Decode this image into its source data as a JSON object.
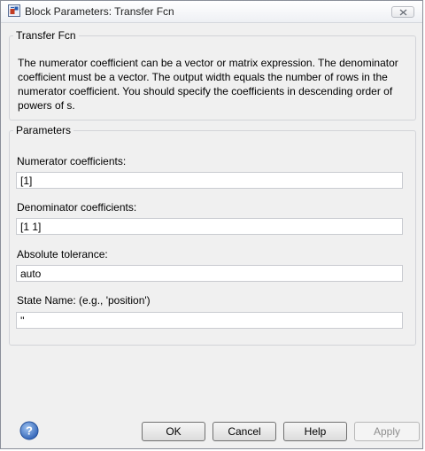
{
  "window": {
    "title": "Block Parameters: Transfer Fcn"
  },
  "block_group": {
    "legend": "Transfer Fcn",
    "description": "The numerator coefficient can be a vector or matrix expression. The denominator coefficient must be a vector. The output width equals the number of rows in the numerator coefficient. You should specify the coefficients in descending order of powers of s."
  },
  "parameters": {
    "legend": "Parameters",
    "fields": [
      {
        "label": "Numerator coefficients:",
        "value": "[1]"
      },
      {
        "label": "Denominator coefficients:",
        "value": "[1 1]"
      },
      {
        "label": "Absolute tolerance:",
        "value": "auto"
      },
      {
        "label": "State Name: (e.g., 'position')",
        "value": "''"
      }
    ]
  },
  "buttons": {
    "ok": "OK",
    "cancel": "Cancel",
    "help": "Help",
    "apply": "Apply"
  },
  "icons": {
    "app": "block-parameters-icon",
    "close": "close-icon",
    "help": "help-question-icon"
  },
  "colors": {
    "dialog_bg": "#f0f0f0",
    "help_icon": "#3a6fc4"
  }
}
